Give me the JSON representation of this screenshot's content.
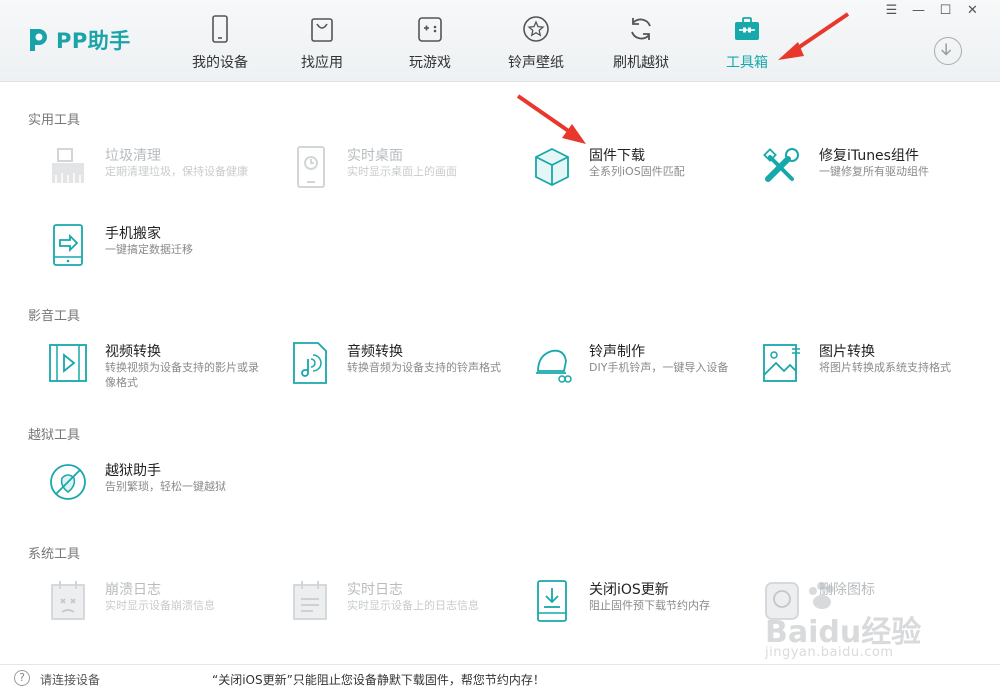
{
  "app": {
    "logo_text": "PP助手"
  },
  "nav": [
    {
      "label": "我的设备",
      "icon": "phone-icon"
    },
    {
      "label": "找应用",
      "icon": "app-bag-icon"
    },
    {
      "label": "玩游戏",
      "icon": "gamepad-icon"
    },
    {
      "label": "铃声壁纸",
      "icon": "star-icon"
    },
    {
      "label": "刷机越狱",
      "icon": "refresh-icon"
    },
    {
      "label": "工具箱",
      "icon": "toolbox-icon",
      "active": true
    }
  ],
  "window_controls": {
    "menu": "☰",
    "minimize": "—",
    "maximize": "☐",
    "close": "✕"
  },
  "sections": {
    "practical": {
      "title": "实用工具",
      "tools": [
        {
          "name": "垃圾清理",
          "desc": "定期清理垃圾，保持设备健康",
          "enabled": false
        },
        {
          "name": "实时桌面",
          "desc": "实时显示桌面上的画面",
          "enabled": false
        },
        {
          "name": "固件下载",
          "desc": "全系列iOS固件匹配",
          "enabled": true
        },
        {
          "name": "修复iTunes组件",
          "desc": "一键修复所有驱动组件",
          "enabled": true
        },
        {
          "name": "手机搬家",
          "desc": "一键搞定数据迁移",
          "enabled": true
        }
      ]
    },
    "media": {
      "title": "影音工具",
      "tools": [
        {
          "name": "视频转换",
          "desc": "转换视频为设备支持的影片或录像格式",
          "enabled": true
        },
        {
          "name": "音频转换",
          "desc": "转换音频为设备支持的铃声格式",
          "enabled": true
        },
        {
          "name": "铃声制作",
          "desc": "DIY手机铃声，一键导入设备",
          "enabled": true
        },
        {
          "name": "图片转换",
          "desc": "将图片转换成系统支持格式",
          "enabled": true
        }
      ]
    },
    "jailbreak": {
      "title": "越狱工具",
      "tools": [
        {
          "name": "越狱助手",
          "desc": "告别繁琐，轻松一键越狱",
          "enabled": true
        }
      ]
    },
    "system": {
      "title": "系统工具",
      "tools": [
        {
          "name": "崩溃日志",
          "desc": "实时显示设备崩溃信息",
          "enabled": false
        },
        {
          "name": "实时日志",
          "desc": "实时显示设备上的日志信息",
          "enabled": false
        },
        {
          "name": "关闭iOS更新",
          "desc": "阻止固件预下载节约内存",
          "enabled": true
        },
        {
          "name": "删除图标",
          "desc": "",
          "enabled": false
        }
      ]
    }
  },
  "footer": {
    "help": "?",
    "status": "请连接设备",
    "notice": "“关闭iOS更新”只能阻止您设备静默下载固件，帮您节约内存！"
  },
  "watermark": {
    "logo": "Baidu经验",
    "url": "jingyan.baidu.com"
  },
  "colors": {
    "accent": "#17a8ab",
    "arrow": "#e8382d",
    "disabled": "#c8cbcd"
  }
}
